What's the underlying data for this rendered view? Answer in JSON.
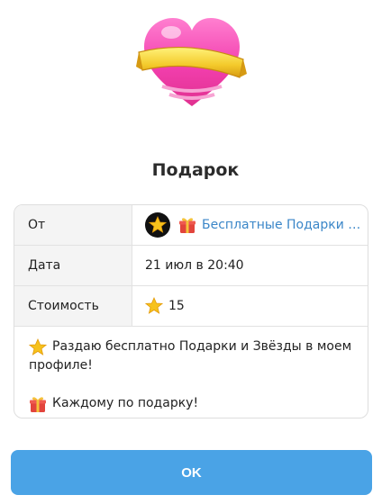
{
  "dialog": {
    "title": "Подарок"
  },
  "details": {
    "from_label": "От",
    "sender_name": "Бесплатные Подарки и...",
    "date_label": "Дата",
    "date_value": "21 июл в 20:40",
    "cost_label": "Стоимость",
    "cost_value": "15"
  },
  "message": {
    "line1": "Раздаю бесплатно Подарки и Звёзды в моем",
    "line2": "профиле!",
    "line3": "Каждому по подарку!"
  },
  "actions": {
    "ok_label": "OK"
  },
  "icons": [
    "heart-gift-icon",
    "star-icon",
    "gift-icon"
  ],
  "colors": {
    "accent": "#4aa3e6",
    "link": "#3a86c8"
  }
}
